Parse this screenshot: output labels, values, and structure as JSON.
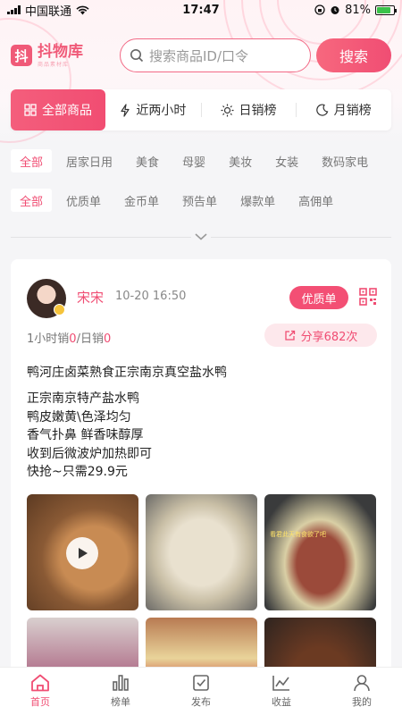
{
  "status_bar": {
    "carrier": "中国联通",
    "time": "17:47",
    "battery": "81%",
    "battery_level": 0.81
  },
  "brand": {
    "name": "抖物库",
    "mark": "抖",
    "tagline": "商品素材库"
  },
  "search": {
    "placeholder": "搜索商品ID/口令",
    "button": "搜索"
  },
  "rank_tabs": [
    {
      "label": "全部商品",
      "icon": "grid-icon",
      "active": true
    },
    {
      "label": "近两小时",
      "icon": "lightning-icon"
    },
    {
      "label": "日销榜",
      "icon": "sun-icon"
    },
    {
      "label": "月销榜",
      "icon": "moon-icon"
    }
  ],
  "categories": [
    "全部",
    "居家日用",
    "美食",
    "母婴",
    "美妆",
    "女装",
    "数码家电"
  ],
  "types": [
    "全部",
    "优质单",
    "金币单",
    "预告单",
    "爆款单",
    "高佣单"
  ],
  "post": {
    "user": "宋宋",
    "time": "10-20 16:50",
    "tag": "优质单",
    "sales_label_1": "1小时销",
    "sales_value_1": "0",
    "sales_sep": "/",
    "sales_label_2": "日销",
    "sales_value_2": "0",
    "share": "分享682次",
    "title": "鸭河庄卤菜熟食正宗南京真空盐水鸭",
    "desc": [
      "正宗南京特产盐水鸭",
      "鸭皮嫩黄\\色泽均匀",
      "香气扑鼻 鲜香味醇厚",
      "收到后微波炉加热即可",
      "快抢~只需29.9元"
    ],
    "photo_caption": "看君此天有食欲了吧"
  },
  "tabbar": [
    {
      "label": "首页",
      "icon": "home-icon",
      "active": true
    },
    {
      "label": "榜单",
      "icon": "bar-chart-icon"
    },
    {
      "label": "发布",
      "icon": "publish-icon"
    },
    {
      "label": "收益",
      "icon": "earnings-icon"
    },
    {
      "label": "我的",
      "icon": "profile-icon"
    }
  ],
  "colors": {
    "accent": "#f04d73",
    "accent_light": "#fde8ec",
    "background": "#f5f5f7"
  }
}
